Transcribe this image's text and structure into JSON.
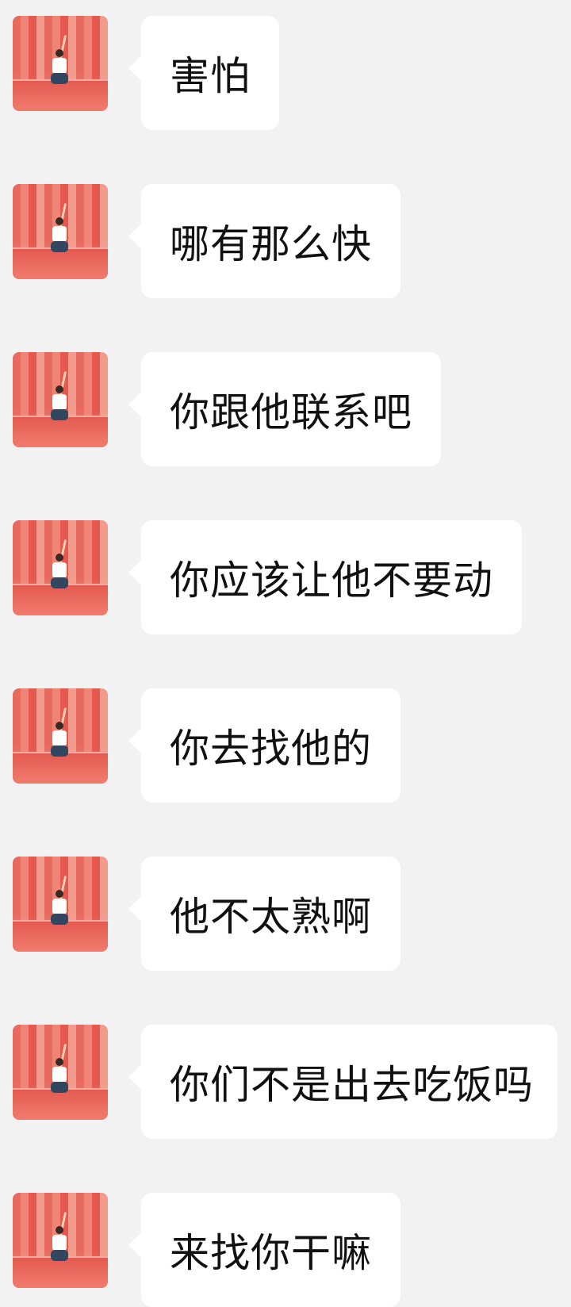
{
  "colors": {
    "background": "#f2f2f2",
    "bubble": "#ffffff",
    "text": "#111111",
    "avatar_red": "#e86a5e"
  },
  "messages": [
    {
      "text": "害怕"
    },
    {
      "text": "哪有那么快"
    },
    {
      "text": "你跟他联系吧"
    },
    {
      "text": "你应该让他不要动"
    },
    {
      "text": "你去找他的"
    },
    {
      "text": "他不太熟啊"
    },
    {
      "text": "你们不是出去吃饭吗"
    },
    {
      "text": "来找你干嘛"
    }
  ]
}
